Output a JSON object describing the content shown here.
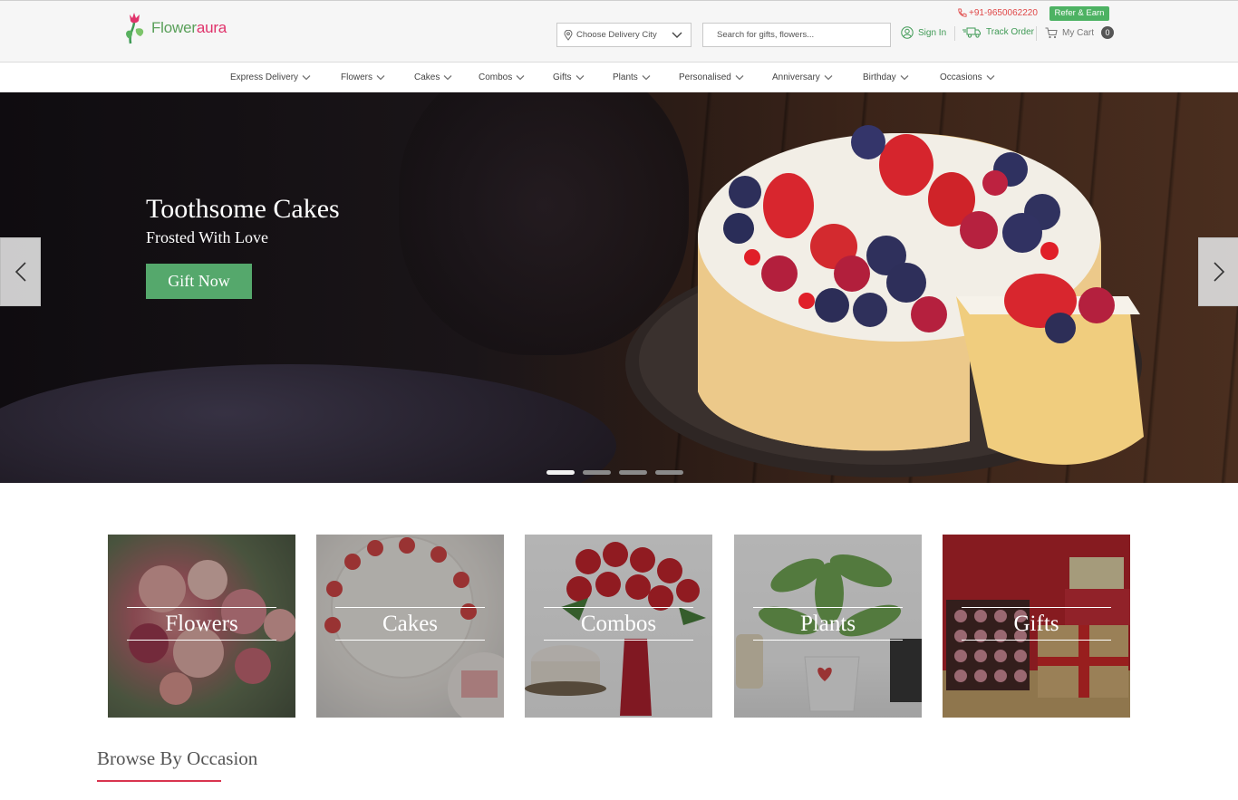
{
  "brand": {
    "name_part1": "Flower",
    "name_part2": "aura"
  },
  "header": {
    "city_placeholder": "Choose Delivery City",
    "search_placeholder": "Search for gifts, flowers...",
    "phone": "+91-9650062220",
    "refer_label": "Refer & Earn",
    "signin_label": "Sign In",
    "track_label": "Track Order",
    "cart_label": "My Cart",
    "cart_count": "0"
  },
  "nav": {
    "items": [
      {
        "label": "Express Delivery"
      },
      {
        "label": "Flowers"
      },
      {
        "label": "Cakes"
      },
      {
        "label": "Combos"
      },
      {
        "label": "Gifts"
      },
      {
        "label": "Plants"
      },
      {
        "label": "Personalised"
      },
      {
        "label": "Anniversary"
      },
      {
        "label": "Birthday"
      },
      {
        "label": "Occasions"
      }
    ]
  },
  "hero": {
    "title": "Toothsome Cakes",
    "subtitle": "Frosted With Love",
    "button_label": "Gift Now",
    "slide_count": 4,
    "active_slide": 1
  },
  "categories": [
    {
      "label": "Flowers"
    },
    {
      "label": "Cakes"
    },
    {
      "label": "Combos"
    },
    {
      "label": "Plants"
    },
    {
      "label": "Gifts"
    }
  ],
  "section": {
    "title": "Browse By Occasion"
  },
  "colors": {
    "brand_green": "#4db263",
    "brand_pink": "#e0336b",
    "accent_red": "#d9344f",
    "hero_button": "#55a86c"
  }
}
